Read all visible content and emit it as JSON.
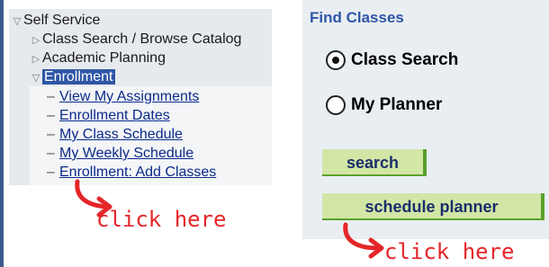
{
  "nav": {
    "root": "Self Service",
    "items": [
      {
        "label": "Class Search / Browse Catalog"
      },
      {
        "label": "Academic Planning"
      },
      {
        "label": "Enrollment"
      }
    ],
    "enrollment_sub": [
      {
        "label": "View My Assignments"
      },
      {
        "label": "Enrollment Dates"
      },
      {
        "label": "My Class Schedule"
      },
      {
        "label": "My Weekly Schedule"
      },
      {
        "label": "Enrollment: Add Classes"
      }
    ]
  },
  "find_classes": {
    "title": "Find Classes",
    "options": [
      {
        "label": "Class Search",
        "selected": true
      },
      {
        "label": "My Planner",
        "selected": false
      }
    ],
    "search_button": "search",
    "planner_button": "schedule planner"
  },
  "annotations": {
    "left": "click here",
    "right": "click here",
    "color": "#e52629"
  },
  "colors": {
    "link": "#0a2a8c",
    "highlight": "#2f56a6",
    "button_bg": "#d2e6a6",
    "button_accent": "#5aa02a"
  }
}
